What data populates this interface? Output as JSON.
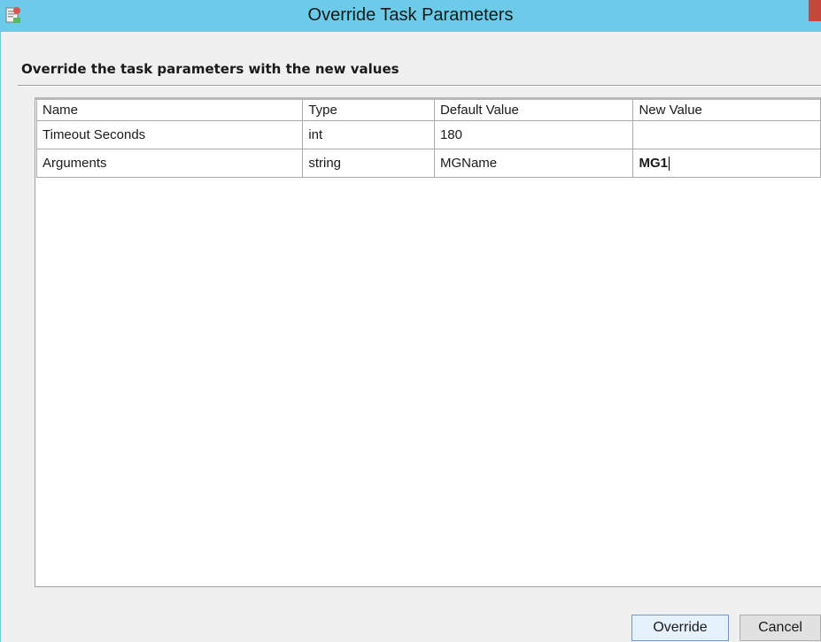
{
  "window": {
    "title": "Override Task Parameters",
    "icon": "task-app-icon"
  },
  "section": {
    "heading": "Override the task parameters with the new values"
  },
  "grid": {
    "columns": [
      "Name",
      "Type",
      "Default Value",
      "New Value"
    ],
    "rows": [
      {
        "name": "Timeout Seconds",
        "type": "int",
        "default": "180",
        "new": ""
      },
      {
        "name": "Arguments",
        "type": "string",
        "default": "MGName",
        "new": "MG1"
      }
    ]
  },
  "buttons": {
    "override_label": "Override",
    "cancel_label": "Cancel"
  },
  "colors": {
    "titlebar": "#6ccbe8",
    "accent_close": "#c9463d"
  }
}
